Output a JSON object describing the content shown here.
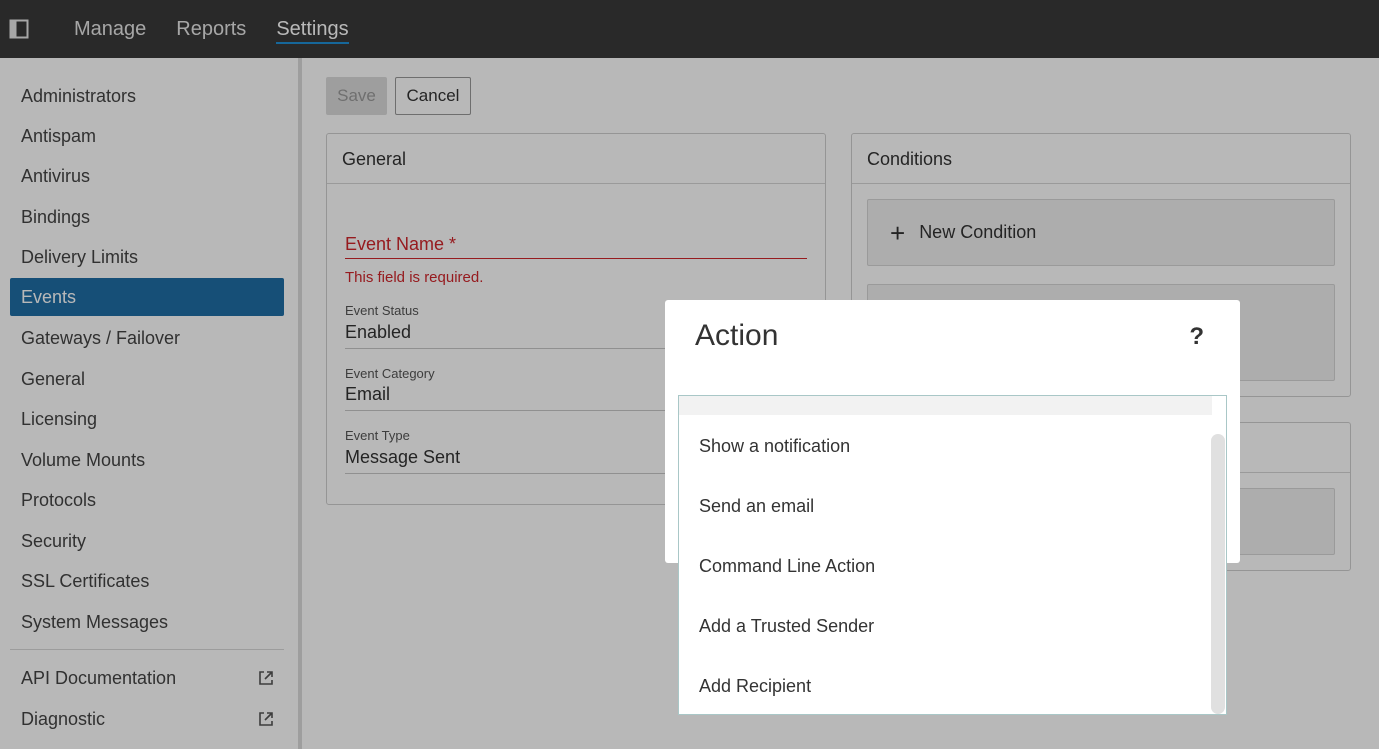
{
  "topbar": {
    "nav": [
      "Manage",
      "Reports",
      "Settings"
    ],
    "active_index": 2
  },
  "sidebar": {
    "items": [
      "Administrators",
      "Antispam",
      "Antivirus",
      "Bindings",
      "Delivery Limits",
      "Events",
      "Gateways / Failover",
      "General",
      "Licensing",
      "Volume Mounts",
      "Protocols",
      "Security",
      "SSL Certificates",
      "System Messages"
    ],
    "active_item": "Events",
    "external_links": [
      "API Documentation",
      "Diagnostic"
    ]
  },
  "toolbar": {
    "save_label": "Save",
    "cancel_label": "Cancel"
  },
  "general_card": {
    "title": "General",
    "event_name_label": "Event Name *",
    "event_name_error": "This field is required.",
    "event_status_label": "Event Status",
    "event_status_value": "Enabled",
    "event_category_label": "Event Category",
    "event_category_value": "Email",
    "event_type_label": "Event Type",
    "event_type_value": "Message Sent"
  },
  "conditions_card": {
    "title": "Conditions",
    "new_condition_label": "New Condition"
  },
  "modal": {
    "title": "Action",
    "help_symbol": "?",
    "options": [
      "Show a notification",
      "Send an email",
      "Command Line Action",
      "Add a Trusted Sender",
      "Add Recipient"
    ]
  },
  "colors": {
    "topbar": "#3a3a3a",
    "accent": "#1f6ea6",
    "error": "#d0262c"
  }
}
